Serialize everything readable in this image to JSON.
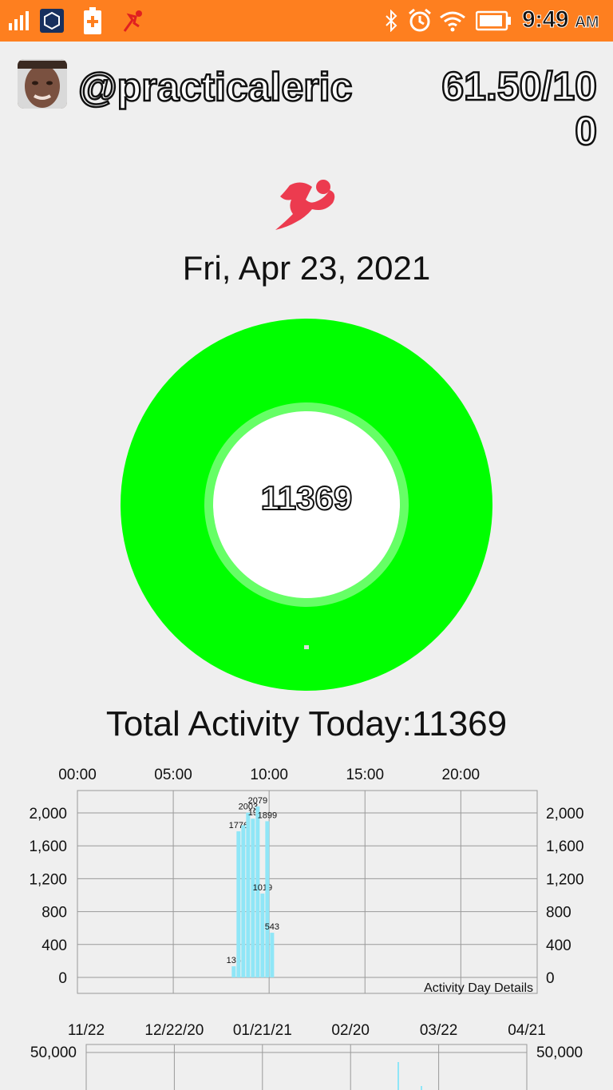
{
  "status_bar": {
    "time": "9:49",
    "ampm": "AM",
    "icons": [
      "signal-icon",
      "crypto-app-icon",
      "battery-plus-icon",
      "runner-app-icon",
      "bluetooth-icon",
      "alarm-icon",
      "wifi-icon",
      "battery-icon"
    ]
  },
  "profile": {
    "username": "@practicaleric",
    "score": "61.50/100"
  },
  "activity": {
    "date": "Fri, Apr 23, 2021",
    "ring_value": "11369",
    "total_text": "Total Activity Today:11369"
  },
  "colors": {
    "status_bar": "#fe7f1f",
    "ring_outer": "#00ff00",
    "ring_inner": "#66ff66",
    "bar": "#8fe6f7"
  },
  "chart_data": [
    {
      "type": "bar",
      "title": "Activity Day Details",
      "x_tick_labels": [
        "00:00",
        "05:00",
        "10:00",
        "15:00",
        "20:00"
      ],
      "y_ticks": [
        "0",
        "400",
        "800",
        "1,200",
        "1,600",
        "2,000"
      ],
      "ylim": [
        0,
        2100
      ],
      "grid": true,
      "bars": [
        {
          "x": 8.05,
          "value": 135,
          "label": "135"
        },
        {
          "x": 8.3,
          "value": 1776,
          "label": "1776"
        },
        {
          "x": 8.55,
          "value": 1850,
          "label": ""
        },
        {
          "x": 8.8,
          "value": 2003,
          "label": "2003"
        },
        {
          "x": 9.05,
          "value": 1930,
          "label": "19"
        },
        {
          "x": 9.3,
          "value": 2079,
          "label": "2079"
        },
        {
          "x": 9.55,
          "value": 1019,
          "label": "1019"
        },
        {
          "x": 9.8,
          "value": 1899,
          "label": "1899"
        },
        {
          "x": 10.05,
          "value": 543,
          "label": "543"
        }
      ]
    },
    {
      "type": "bar",
      "x_tick_labels": [
        "11/22",
        "12/22/20",
        "01/21/21",
        "02/20",
        "03/22",
        "04/21"
      ],
      "y_ticks": [
        "50,000"
      ]
    }
  ]
}
